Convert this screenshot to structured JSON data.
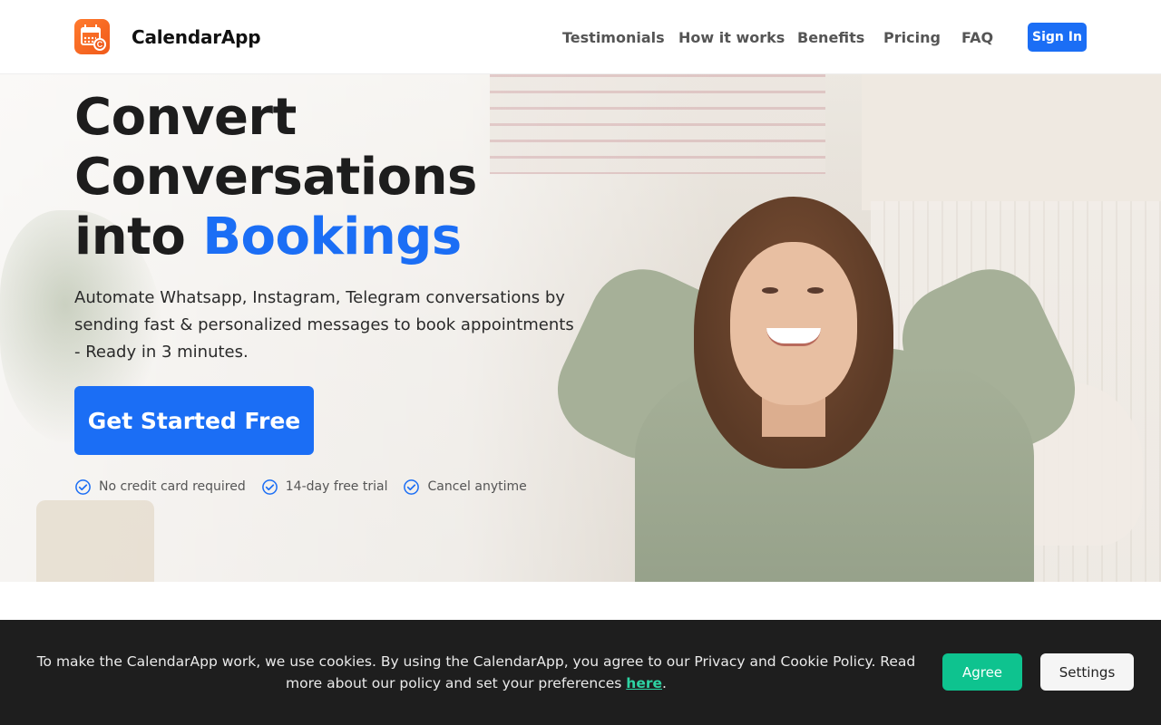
{
  "header": {
    "brand": "CalendarApp",
    "logo_icon": "calendar-icon",
    "nav": [
      "Testimonials",
      "How it works",
      "Benefits",
      "Pricing",
      "FAQ"
    ],
    "sign_in": "Sign In"
  },
  "hero": {
    "headline_line1": "Convert",
    "headline_line2": "Conversations",
    "headline_line3_prefix": "into ",
    "headline_accent": "Bookings",
    "subheadline": "Automate Whatsapp, Instagram, Telegram conversations by sending fast & personalized messages to book appointments - Ready in 3 minutes.",
    "cta": "Get Started Free",
    "checks": [
      "No credit card required",
      "14-day free trial",
      "Cancel anytime"
    ]
  },
  "cookie": {
    "text_before": "To make the CalendarApp work, we use cookies. By using the CalendarApp, you agree to our Privacy and Cookie Policy. Read more about our policy and set your preferences ",
    "link": "here",
    "text_after": ".",
    "agree": "Agree",
    "settings": "Settings"
  },
  "colors": {
    "accent": "#1b6ef5",
    "cookie_bg": "#1e1e1e",
    "agree_bg": "#0ec38f",
    "logo_orange": "#f05a1a"
  }
}
